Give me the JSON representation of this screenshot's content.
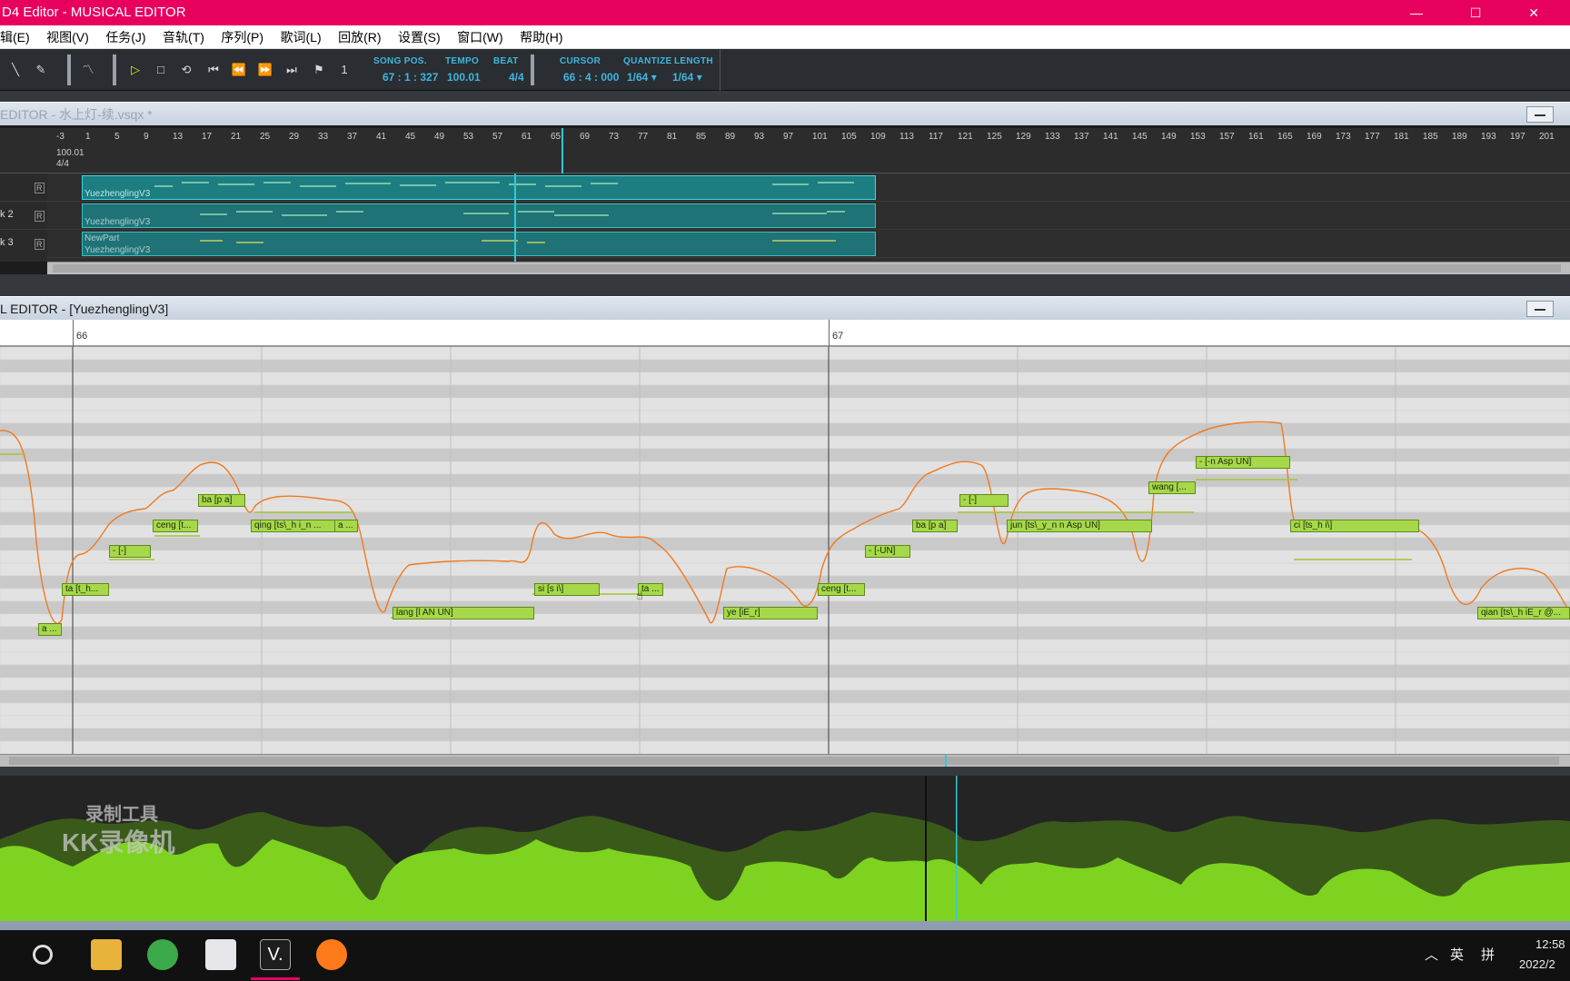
{
  "window": {
    "title": "D4 Editor - MUSICAL EDITOR",
    "controls": "— ☐ ✕"
  },
  "menu": [
    "辑(E)",
    "视图(V)",
    "任务(J)",
    "音轨(T)",
    "序列(P)",
    "歌词(L)",
    "回放(R)",
    "设置(S)",
    "窗口(W)",
    "帮助(H)"
  ],
  "toolbar": {
    "song_pos_label": "SONG POS.",
    "song_pos_value": "67 : 1 : 327",
    "tempo_label": "TEMPO",
    "tempo_value": "100.01",
    "beat_label": "BEAT",
    "beat_value": "4/4",
    "cursor_label": "CURSOR",
    "cursor_value": "66 : 4 : 000",
    "quantize_label": "QUANTIZE",
    "quantize_value": "1/64 ▾",
    "length_label": "LENGTH",
    "length_value": "1/64 ▾"
  },
  "track_editor": {
    "title": "EDITOR - 水上灯-续.vsqx *",
    "ruler_ticks": [
      "-3",
      "1",
      "5",
      "9",
      "13",
      "17",
      "21",
      "25",
      "29",
      "33",
      "37",
      "41",
      "45",
      "49",
      "53",
      "57",
      "61",
      "65",
      "69",
      "73",
      "77",
      "81",
      "85",
      "89",
      "93",
      "97",
      "101",
      "105",
      "109",
      "113",
      "117",
      "121",
      "125",
      "129",
      "133",
      "137",
      "141",
      "145",
      "149",
      "153",
      "157",
      "161",
      "165",
      "169",
      "173",
      "177",
      "181",
      "185",
      "189",
      "193",
      "197",
      "201"
    ],
    "tempo_marker": "100.01",
    "beat_marker": "4/4",
    "tracks": [
      {
        "label": "",
        "parts": [
          "YuezhenglingV3"
        ]
      },
      {
        "label": "k 2",
        "parts": [
          "YuezhenglingV3"
        ]
      },
      {
        "label": "k 3",
        "parts": [
          "NewPart",
          "YuezhenglingV3"
        ]
      }
    ]
  },
  "musical_editor": {
    "title": "L EDITOR -  [YuezhenglingV3]",
    "measures": [
      "66",
      "67"
    ],
    "notes": [
      {
        "lyric": "a ..."
      },
      {
        "lyric": "ta [t_h..."
      },
      {
        "lyric": "- [-]"
      },
      {
        "lyric": "ceng [t..."
      },
      {
        "lyric": "ba [p a]"
      },
      {
        "lyric": "qing [ts\\_h i_n ..."
      },
      {
        "lyric": "a ..."
      },
      {
        "lyric": "lang [l AN UN]"
      },
      {
        "lyric": "si [s i\\]"
      },
      {
        "lyric": "ta ..."
      },
      {
        "lyric": "ye [iE_r]"
      },
      {
        "lyric": "ceng [t..."
      },
      {
        "lyric": "- [-UN]"
      },
      {
        "lyric": "ba [p a]"
      },
      {
        "lyric": "- [-]"
      },
      {
        "lyric": "jun [ts\\_y_n n Asp UN]"
      },
      {
        "lyric": "wang [..."
      },
      {
        "lyric": "- [-n Asp UN]"
      },
      {
        "lyric": "ci [ts_h i\\]"
      },
      {
        "lyric": "qian [ts\\_h iE_r @..."
      }
    ]
  },
  "watermark": {
    "line1": "录制工具",
    "line2": "KK录像机"
  },
  "taskbar": {
    "ime1": "英",
    "ime2": "拼",
    "time": "12:58",
    "date": "2022/2"
  },
  "colors": {
    "accent": "#e8005f",
    "note": "#a6d84a",
    "pitch": "#f07a20",
    "wave": "#7ed321",
    "toolbar_text": "#3fb6e0"
  }
}
